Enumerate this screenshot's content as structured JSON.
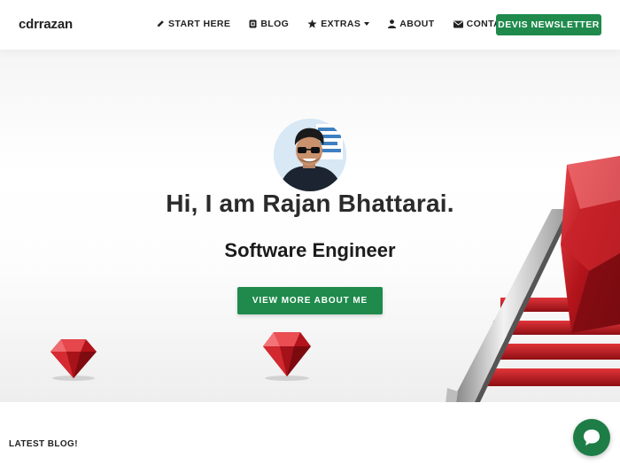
{
  "brand": {
    "name": "cdrrazan"
  },
  "nav": {
    "items": [
      {
        "label": "START HERE",
        "icon": "pencil-icon"
      },
      {
        "label": "BLOG",
        "icon": "blog-icon"
      },
      {
        "label": "EXTRAS",
        "icon": "star-icon",
        "dropdown": true
      },
      {
        "label": "ABOUT",
        "icon": "user-icon"
      },
      {
        "label": "CONTACT",
        "icon": "envelope-icon"
      }
    ],
    "cta_label": "DEVIS NEWSLETTER"
  },
  "hero": {
    "title": "Hi, I am Rajan Bhattarai.",
    "subtitle": "Software Engineer",
    "button_label": "VIEW MORE ABOUT ME"
  },
  "latest": {
    "heading": "LATEST BLOG!"
  },
  "colors": {
    "accent": "#1f8a4c",
    "ruby": "#c3151c",
    "text": "#222222"
  }
}
